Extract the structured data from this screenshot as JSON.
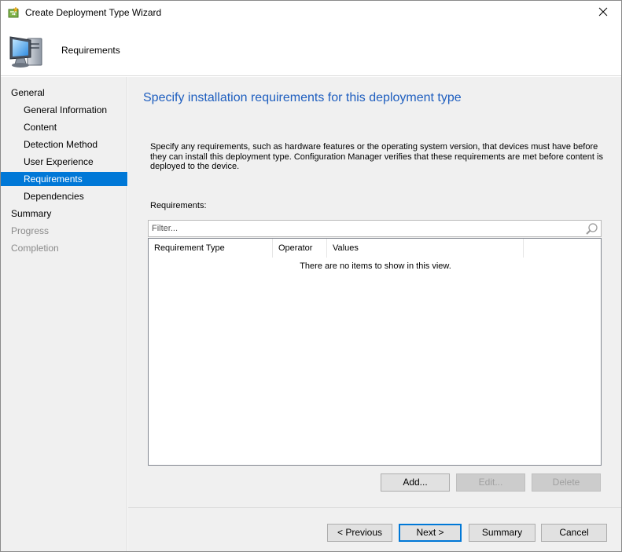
{
  "window": {
    "title": "Create Deployment Type Wizard",
    "icon": "wizard-icon",
    "close_icon": "close-icon"
  },
  "banner": {
    "title": "Requirements",
    "icon": "computer-icon"
  },
  "nav": {
    "items": [
      {
        "label": "General",
        "level": 0,
        "state": "normal"
      },
      {
        "label": "General Information",
        "level": 1,
        "state": "normal"
      },
      {
        "label": "Content",
        "level": 1,
        "state": "normal"
      },
      {
        "label": "Detection Method",
        "level": 1,
        "state": "normal"
      },
      {
        "label": "User Experience",
        "level": 1,
        "state": "normal"
      },
      {
        "label": "Requirements",
        "level": 1,
        "state": "selected"
      },
      {
        "label": "Dependencies",
        "level": 1,
        "state": "normal"
      },
      {
        "label": "Summary",
        "level": 0,
        "state": "normal"
      },
      {
        "label": "Progress",
        "level": 0,
        "state": "disabled"
      },
      {
        "label": "Completion",
        "level": 0,
        "state": "disabled"
      }
    ]
  },
  "main": {
    "heading": "Specify installation requirements for this deployment type",
    "description": "Specify any requirements, such as hardware features or the operating system version, that devices must have before they can install this deployment type. Configuration Manager verifies that these requirements are met before content is deployed to the device.",
    "requirements_label": "Requirements:",
    "filter": {
      "placeholder": "Filter...",
      "value": "",
      "icon": "search-icon"
    },
    "columns": [
      "Requirement Type",
      "Operator",
      "Values"
    ],
    "empty_text": "There are no items to show in this view.",
    "buttons": {
      "add": "Add...",
      "edit": "Edit...",
      "delete": "Delete"
    }
  },
  "footer": {
    "previous": "< Previous",
    "next": "Next >",
    "summary": "Summary",
    "cancel": "Cancel"
  },
  "colors": {
    "accent": "#0078d7",
    "heading": "#1e5ebf",
    "disabled_text": "#8a8a8a"
  }
}
